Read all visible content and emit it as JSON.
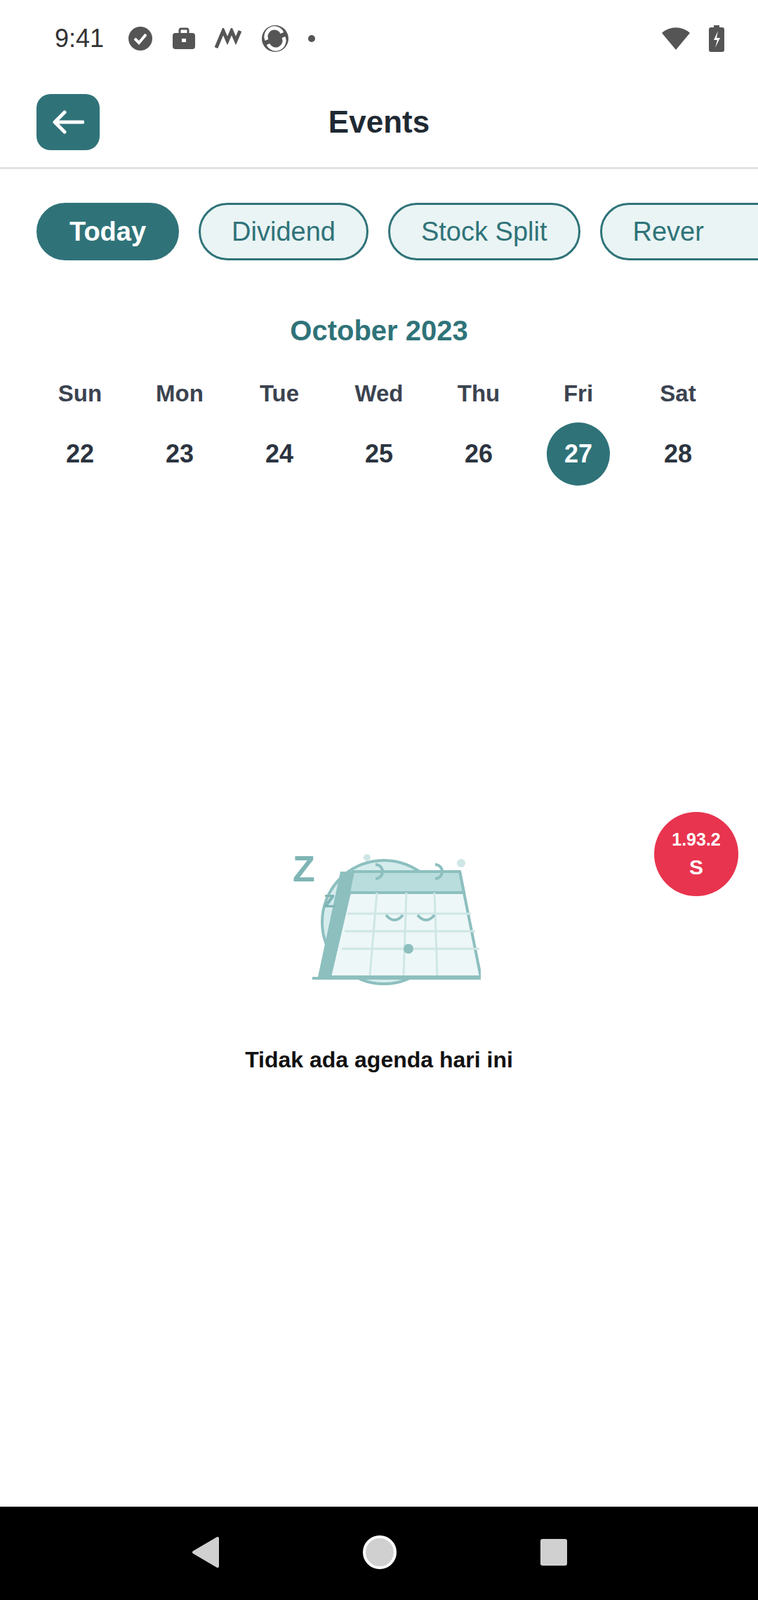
{
  "status_bar": {
    "time": "9:41"
  },
  "header": {
    "title": "Events"
  },
  "filters": [
    {
      "label": "Today",
      "selected": true
    },
    {
      "label": "Dividend",
      "selected": false
    },
    {
      "label": "Stock Split",
      "selected": false
    },
    {
      "label": "Rever",
      "selected": false
    }
  ],
  "calendar": {
    "month": "October 2023",
    "days": [
      {
        "weekday": "Sun",
        "date": "22",
        "selected": false
      },
      {
        "weekday": "Mon",
        "date": "23",
        "selected": false
      },
      {
        "weekday": "Tue",
        "date": "24",
        "selected": false
      },
      {
        "weekday": "Wed",
        "date": "25",
        "selected": false
      },
      {
        "weekday": "Thu",
        "date": "26",
        "selected": false
      },
      {
        "weekday": "Fri",
        "date": "27",
        "selected": true
      },
      {
        "weekday": "Sat",
        "date": "28",
        "selected": false
      }
    ]
  },
  "illustration": {
    "sleep_marks": [
      "Z",
      "z"
    ]
  },
  "empty_state": {
    "message": "Tidak ada agenda hari ini"
  },
  "debug_badge": {
    "version": "1.93.2",
    "flavor": "S"
  }
}
